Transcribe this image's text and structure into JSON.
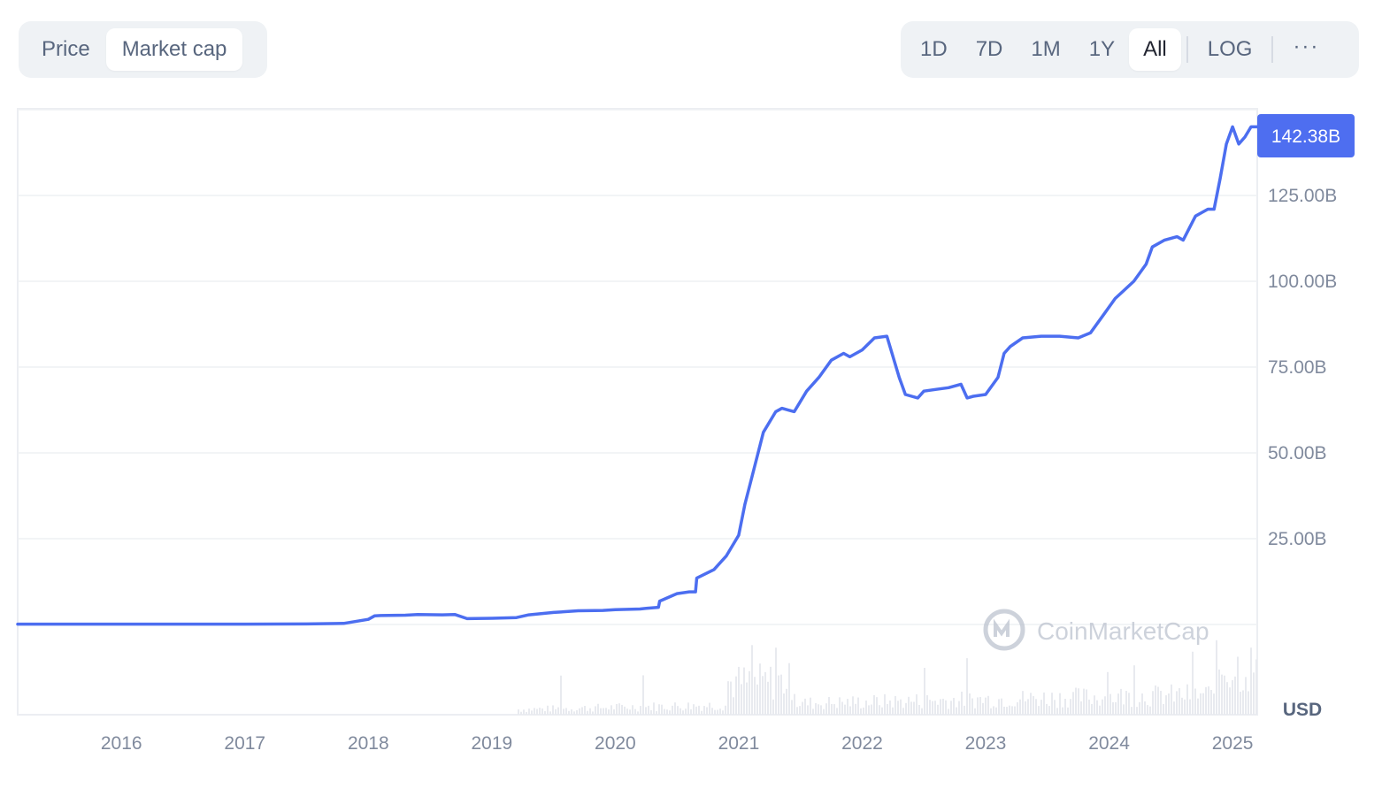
{
  "toolbar": {
    "metric_options": [
      {
        "label": "Price",
        "active": false
      },
      {
        "label": "Market cap",
        "active": true
      }
    ],
    "range_options": [
      {
        "label": "1D",
        "active": false
      },
      {
        "label": "7D",
        "active": false
      },
      {
        "label": "1M",
        "active": false
      },
      {
        "label": "1Y",
        "active": false
      },
      {
        "label": "All",
        "active": true
      }
    ],
    "log_label": "LOG",
    "more_label": "···"
  },
  "chart_data": {
    "type": "line",
    "title": "",
    "xlabel": "",
    "ylabel": "",
    "currency_label": "USD",
    "watermark": "CoinMarketCap",
    "current_value_label": "142.38B",
    "current_value": 142.38,
    "x_tick_labels": [
      "2016",
      "2017",
      "2018",
      "2019",
      "2020",
      "2021",
      "2022",
      "2023",
      "2024",
      "2025"
    ],
    "y_tick_labels": [
      "25.00B",
      "50.00B",
      "75.00B",
      "100.00B",
      "125.00B"
    ],
    "y_ticks": [
      25,
      50,
      75,
      100,
      125
    ],
    "ylim": [
      0,
      150
    ],
    "xlim": [
      2015.16,
      2025.2
    ],
    "grid": true,
    "colors": {
      "line": "#4c6ef0",
      "badge": "#4e6ef0",
      "grid": "#eef0f3",
      "volume": "#e8eaef"
    },
    "series": [
      {
        "values_unit": "billion USD",
        "x": [
          2015.16,
          2017.0,
          2017.5,
          2017.8,
          2018.0,
          2018.05,
          2018.1,
          2018.3,
          2018.4,
          2018.6,
          2018.7,
          2018.8,
          2019.0,
          2019.2,
          2019.3,
          2019.5,
          2019.7,
          2019.9,
          2020.0,
          2020.2,
          2020.25,
          2020.35,
          2020.36,
          2020.5,
          2020.6,
          2020.65,
          2020.66,
          2020.8,
          2020.9,
          2021.0,
          2021.05,
          2021.1,
          2021.2,
          2021.3,
          2021.35,
          2021.45,
          2021.55,
          2021.65,
          2021.75,
          2021.85,
          2021.9,
          2022.0,
          2022.1,
          2022.2,
          2022.3,
          2022.35,
          2022.45,
          2022.5,
          2022.6,
          2022.7,
          2022.8,
          2022.85,
          2022.9,
          2023.0,
          2023.1,
          2023.15,
          2023.2,
          2023.3,
          2023.45,
          2023.6,
          2023.75,
          2023.85,
          2023.95,
          2024.05,
          2024.2,
          2024.3,
          2024.35,
          2024.45,
          2024.55,
          2024.6,
          2024.7,
          2024.75,
          2024.8,
          2024.85,
          2024.9,
          2024.95,
          2025.0,
          2025.05,
          2025.1,
          2025.15,
          2025.2
        ],
        "values": [
          0.1,
          0.1,
          0.15,
          0.3,
          1.5,
          2.5,
          2.6,
          2.7,
          2.9,
          2.8,
          2.9,
          1.7,
          1.8,
          2.0,
          2.8,
          3.5,
          4.0,
          4.1,
          4.3,
          4.5,
          4.7,
          5.0,
          6.8,
          9.0,
          9.5,
          9.5,
          13.5,
          16.0,
          20.0,
          26.0,
          35.0,
          42.0,
          56.0,
          62.0,
          63.0,
          62.0,
          68.0,
          72.0,
          77.0,
          79.0,
          78.0,
          80.0,
          83.5,
          84.0,
          72.0,
          67.0,
          66.0,
          68.0,
          68.5,
          69.0,
          70.0,
          66.0,
          66.5,
          67.0,
          72.0,
          79.0,
          81.0,
          83.5,
          84.0,
          84.0,
          83.5,
          85.0,
          90.0,
          95.0,
          100.0,
          105.0,
          110.0,
          112.0,
          113.0,
          112.0,
          119.0,
          120.0,
          121.0,
          121.0,
          130.0,
          140.0,
          145.0,
          140.0,
          142.0,
          145.0,
          145.0
        ]
      }
    ]
  }
}
